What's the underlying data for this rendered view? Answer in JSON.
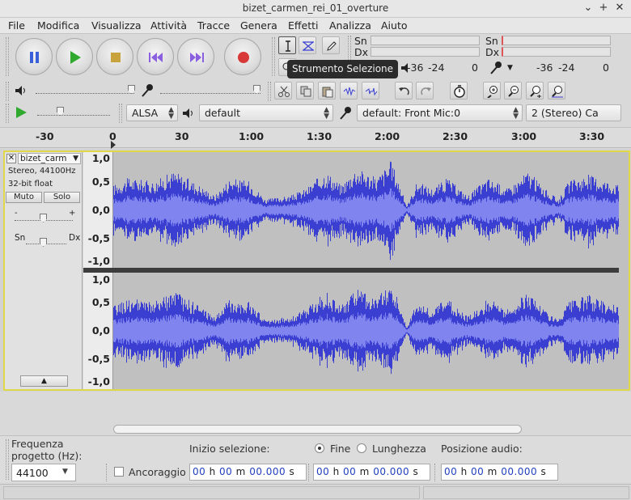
{
  "window": {
    "title": "bizet_carmen_rei_01_overture"
  },
  "menu": [
    "File",
    "Modifica",
    "Visualizza",
    "Attività",
    "Tracce",
    "Genera",
    "Effetti",
    "Analizza",
    "Aiuto"
  ],
  "meters": {
    "play_left": "Sn",
    "play_right": "Dx",
    "rec_left": "Sn",
    "rec_right": "Dx",
    "scale_play": [
      "-36",
      "-24",
      "0"
    ],
    "scale_rec": [
      "-36",
      "-24",
      "0"
    ]
  },
  "tooltip": "Strumento Selezione",
  "device": {
    "host": "ALSA",
    "output": "default",
    "input": "default: Front Mic:0",
    "channels": "2 (Stereo) Ca"
  },
  "ruler": {
    "labels": [
      "-30",
      "0",
      "30",
      "1:00",
      "1:30",
      "2:00",
      "2:30",
      "3:00",
      "3:30"
    ]
  },
  "track": {
    "name": "bizet_carm",
    "info_line1": "Stereo, 44100Hz",
    "info_line2": "32-bit float",
    "mute_label": "Muto",
    "solo_label": "Solo",
    "gain_minus": "-",
    "gain_plus": "+",
    "pan_left": "Sn",
    "pan_right": "Dx",
    "scale_top": [
      "1,0",
      "0,5",
      "0,0",
      "-0,5",
      "-1,0"
    ],
    "scale_bottom": [
      "1,0",
      "0,5",
      "0,0",
      "-0,5",
      "-1,0"
    ]
  },
  "colors": {
    "waveform": "#3a3fd1",
    "waveform_rms": "#7f84ee",
    "wave_bg": "#c0c0c0",
    "selected_frame": "#e0d84a"
  },
  "selection_bar": {
    "rate_label_1": "Frequenza",
    "rate_label_2": "progetto (Hz):",
    "rate_value": "44100",
    "snap_label": "Ancoraggio",
    "sel_start_label": "Inizio selezione:",
    "end_label": "Fine",
    "length_label": "Lunghezza",
    "audio_pos_label": "Posizione audio:",
    "time_start": {
      "h": "00",
      "m": "00",
      "s": "00.000"
    },
    "time_end": {
      "h": "00",
      "m": "00",
      "s": "00.000"
    },
    "time_audio": {
      "h": "00",
      "m": "00",
      "s": "00.000"
    },
    "unit_h": "h",
    "unit_m": "m",
    "unit_s": "s"
  }
}
